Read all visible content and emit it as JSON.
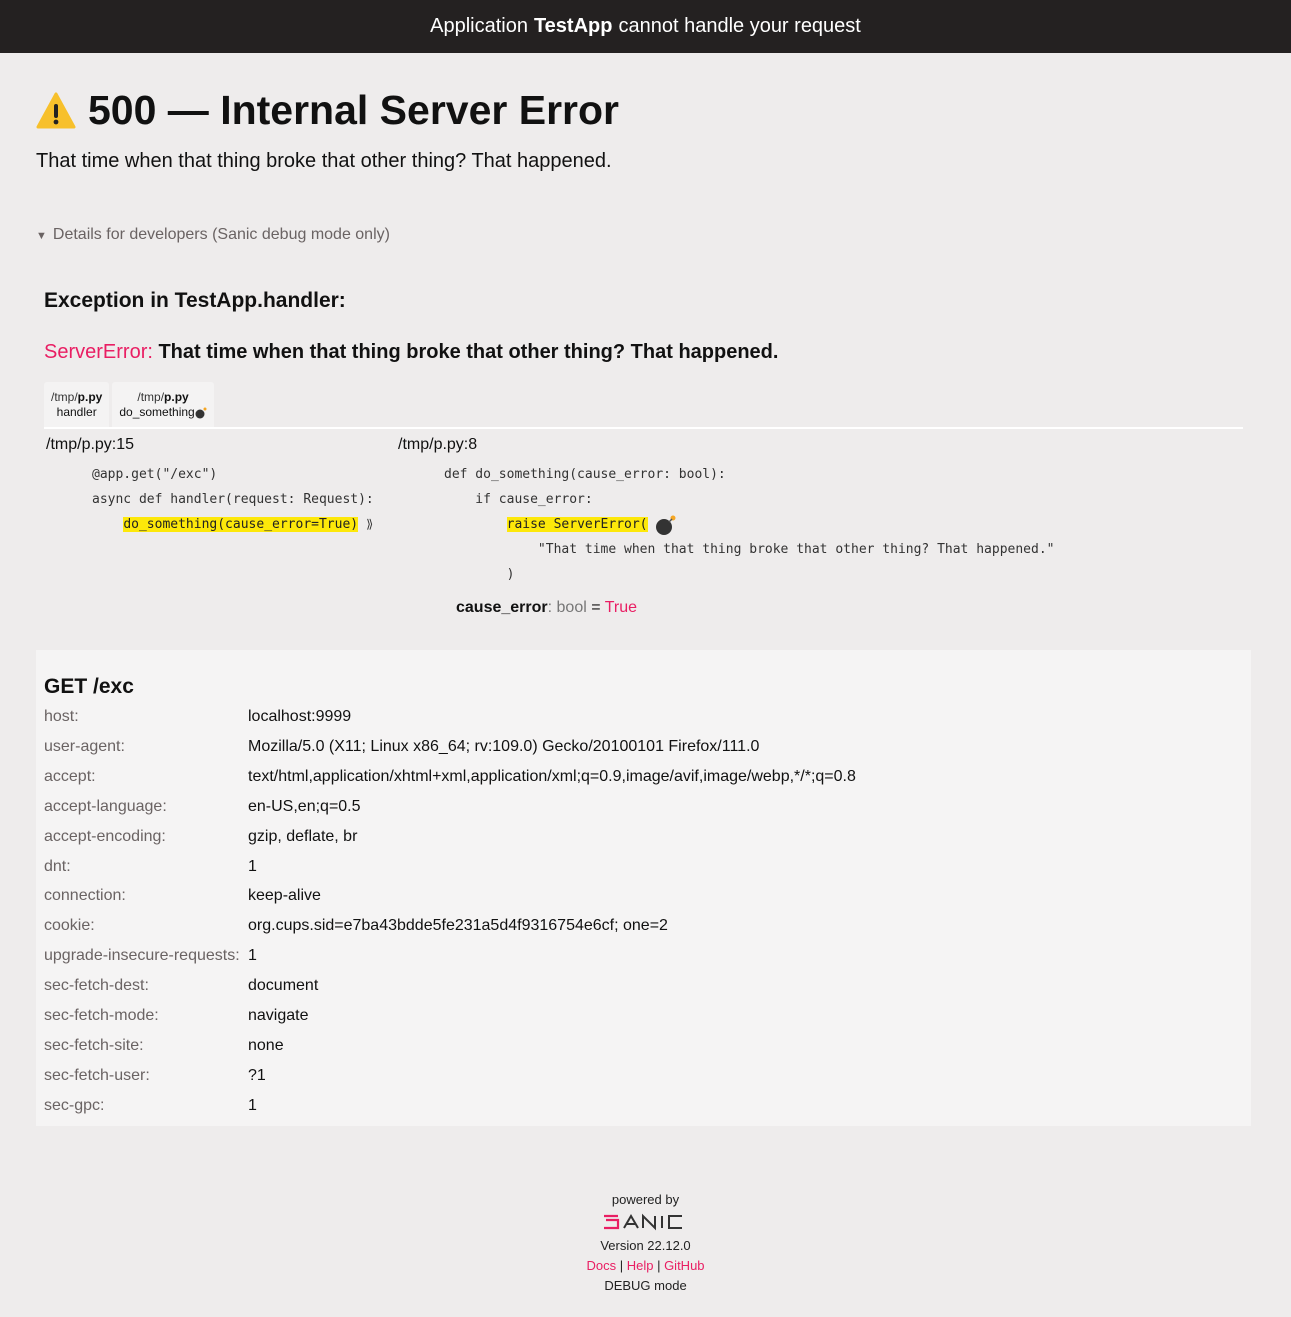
{
  "topbar": {
    "prefix": "Application",
    "app_name": "TestApp",
    "suffix": "cannot handle your request"
  },
  "error": {
    "title": "500 — Internal Server Error",
    "message": "That time when that thing broke that other thing? That happened."
  },
  "details": {
    "summary": "Details for developers (Sanic debug mode only)",
    "exception_title": "Exception in TestApp.handler:",
    "error_type": "ServerError:",
    "error_message": "That time when that thing broke that other thing? That happened."
  },
  "tabs": [
    {
      "file": "/tmp/",
      "file_bold": "p.py",
      "func": "handler"
    },
    {
      "file": "/tmp/",
      "file_bold": "p.py",
      "func": "do_something"
    }
  ],
  "frames": [
    {
      "path": "/tmp/p.py:15",
      "lines": [
        "@app.get(\"/exc\")",
        "async def handler(request: Request):",
        "    do_something(cause_error=True)"
      ]
    },
    {
      "path": "/tmp/p.py:8",
      "lines": [
        "def do_something(cause_error: bool):",
        "    if cause_error:",
        "        raise ServerError(",
        "            \"That time when that thing broke that other thing? That happened.\"",
        "        )"
      ]
    }
  ],
  "variable": {
    "name": "cause_error",
    "type": ": bool",
    "eq": " = ",
    "value": "True"
  },
  "request": {
    "title": "GET /exc",
    "headers": [
      {
        "key": "host:",
        "value": "localhost:9999"
      },
      {
        "key": "user-agent:",
        "value": "Mozilla/5.0 (X11; Linux x86_64; rv:109.0) Gecko/20100101 Firefox/111.0"
      },
      {
        "key": "accept:",
        "value": "text/html,application/xhtml+xml,application/xml;q=0.9,image/avif,image/webp,*/*;q=0.8"
      },
      {
        "key": "accept-language:",
        "value": "en-US,en;q=0.5"
      },
      {
        "key": "accept-encoding:",
        "value": "gzip, deflate, br"
      },
      {
        "key": "dnt:",
        "value": "1"
      },
      {
        "key": "connection:",
        "value": "keep-alive"
      },
      {
        "key": "cookie:",
        "value": "org.cups.sid=e7ba43bdde5fe231a5d4f9316754e6cf; one=2"
      },
      {
        "key": "upgrade-insecure-requests:",
        "value": "1"
      },
      {
        "key": "sec-fetch-dest:",
        "value": "document"
      },
      {
        "key": "sec-fetch-mode:",
        "value": "navigate"
      },
      {
        "key": "sec-fetch-site:",
        "value": "none"
      },
      {
        "key": "sec-fetch-user:",
        "value": "?1"
      },
      {
        "key": "sec-gpc:",
        "value": "1"
      }
    ]
  },
  "footer": {
    "powered_by": "powered by",
    "logo_text": "SANIC",
    "version": "Version 22.12.0",
    "docs": "Docs",
    "help": "Help",
    "github": "GitHub",
    "sep": " | ",
    "mode": "DEBUG mode"
  },
  "colors": {
    "accent": "#e91e63",
    "highlight": "#fde80a",
    "topbar": "#242121"
  }
}
